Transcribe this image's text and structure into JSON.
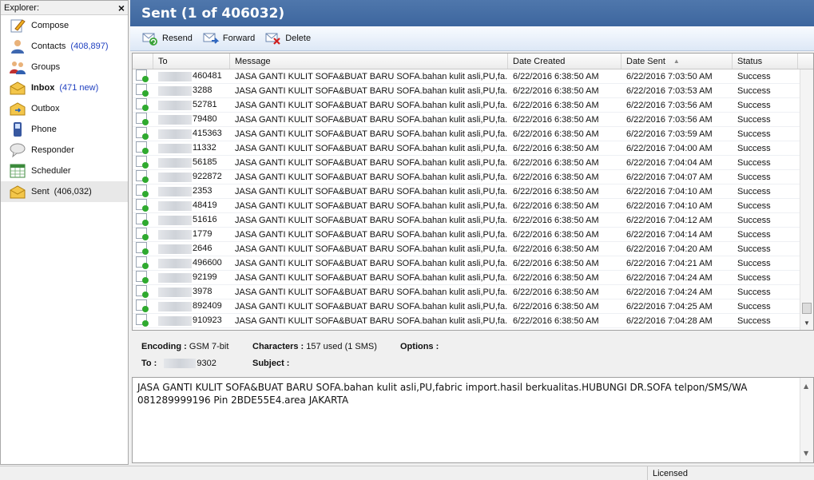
{
  "sidebar": {
    "title": "Explorer:",
    "items": [
      {
        "label": "Compose",
        "count": "",
        "icon": "compose-icon"
      },
      {
        "label": "Contacts",
        "count": "(408,897)",
        "icon": "contacts-icon"
      },
      {
        "label": "Groups",
        "count": "",
        "icon": "groups-icon"
      },
      {
        "label": "Inbox",
        "count": "(471 new)",
        "icon": "inbox-icon"
      },
      {
        "label": "Outbox",
        "count": "",
        "icon": "outbox-icon"
      },
      {
        "label": "Phone",
        "count": "",
        "icon": "phone-icon"
      },
      {
        "label": "Responder",
        "count": "",
        "icon": "responder-icon"
      },
      {
        "label": "Scheduler",
        "count": "",
        "icon": "scheduler-icon"
      },
      {
        "label": "Sent",
        "count": "(406,032)",
        "icon": "sent-icon"
      }
    ]
  },
  "header": {
    "title": "Sent (1 of 406032)"
  },
  "toolbar": {
    "resend": "Resend",
    "forward": "Forward",
    "delete": "Delete"
  },
  "grid": {
    "columns": [
      "To",
      "Message",
      "Date Created",
      "Date Sent",
      "Status"
    ],
    "rows": [
      {
        "to": "460481",
        "message": "JASA GANTI KULIT SOFA&BUAT BARU SOFA.bahan kulit asli,PU,fa...",
        "created": "6/22/2016 6:38:50 AM",
        "sent": "6/22/2016 7:03:50 AM",
        "status": "Success"
      },
      {
        "to": "3288",
        "message": "JASA GANTI KULIT SOFA&BUAT BARU SOFA.bahan kulit asli,PU,fa...",
        "created": "6/22/2016 6:38:50 AM",
        "sent": "6/22/2016 7:03:53 AM",
        "status": "Success"
      },
      {
        "to": "52781",
        "message": "JASA GANTI KULIT SOFA&BUAT BARU SOFA.bahan kulit asli,PU,fa...",
        "created": "6/22/2016 6:38:50 AM",
        "sent": "6/22/2016 7:03:56 AM",
        "status": "Success"
      },
      {
        "to": "79480",
        "message": "JASA GANTI KULIT SOFA&BUAT BARU SOFA.bahan kulit asli,PU,fa...",
        "created": "6/22/2016 6:38:50 AM",
        "sent": "6/22/2016 7:03:56 AM",
        "status": "Success"
      },
      {
        "to": "415363",
        "message": "JASA GANTI KULIT SOFA&BUAT BARU SOFA.bahan kulit asli,PU,fa...",
        "created": "6/22/2016 6:38:50 AM",
        "sent": "6/22/2016 7:03:59 AM",
        "status": "Success"
      },
      {
        "to": "11332",
        "message": "JASA GANTI KULIT SOFA&BUAT BARU SOFA.bahan kulit asli,PU,fa...",
        "created": "6/22/2016 6:38:50 AM",
        "sent": "6/22/2016 7:04:00 AM",
        "status": "Success"
      },
      {
        "to": "56185",
        "message": "JASA GANTI KULIT SOFA&BUAT BARU SOFA.bahan kulit asli,PU,fa...",
        "created": "6/22/2016 6:38:50 AM",
        "sent": "6/22/2016 7:04:04 AM",
        "status": "Success"
      },
      {
        "to": "922872",
        "message": "JASA GANTI KULIT SOFA&BUAT BARU SOFA.bahan kulit asli,PU,fa...",
        "created": "6/22/2016 6:38:50 AM",
        "sent": "6/22/2016 7:04:07 AM",
        "status": "Success"
      },
      {
        "to": "2353",
        "message": "JASA GANTI KULIT SOFA&BUAT BARU SOFA.bahan kulit asli,PU,fa...",
        "created": "6/22/2016 6:38:50 AM",
        "sent": "6/22/2016 7:04:10 AM",
        "status": "Success"
      },
      {
        "to": "48419",
        "message": "JASA GANTI KULIT SOFA&BUAT BARU SOFA.bahan kulit asli,PU,fa...",
        "created": "6/22/2016 6:38:50 AM",
        "sent": "6/22/2016 7:04:10 AM",
        "status": "Success"
      },
      {
        "to": "51616",
        "message": "JASA GANTI KULIT SOFA&BUAT BARU SOFA.bahan kulit asli,PU,fa...",
        "created": "6/22/2016 6:38:50 AM",
        "sent": "6/22/2016 7:04:12 AM",
        "status": "Success"
      },
      {
        "to": "1779",
        "message": "JASA GANTI KULIT SOFA&BUAT BARU SOFA.bahan kulit asli,PU,fa...",
        "created": "6/22/2016 6:38:50 AM",
        "sent": "6/22/2016 7:04:14 AM",
        "status": "Success"
      },
      {
        "to": "2646",
        "message": "JASA GANTI KULIT SOFA&BUAT BARU SOFA.bahan kulit asli,PU,fa...",
        "created": "6/22/2016 6:38:50 AM",
        "sent": "6/22/2016 7:04:20 AM",
        "status": "Success"
      },
      {
        "to": "496600",
        "message": "JASA GANTI KULIT SOFA&BUAT BARU SOFA.bahan kulit asli,PU,fa...",
        "created": "6/22/2016 6:38:50 AM",
        "sent": "6/22/2016 7:04:21 AM",
        "status": "Success"
      },
      {
        "to": "92199",
        "message": "JASA GANTI KULIT SOFA&BUAT BARU SOFA.bahan kulit asli,PU,fa...",
        "created": "6/22/2016 6:38:50 AM",
        "sent": "6/22/2016 7:04:24 AM",
        "status": "Success"
      },
      {
        "to": "3978",
        "message": "JASA GANTI KULIT SOFA&BUAT BARU SOFA.bahan kulit asli,PU,fa...",
        "created": "6/22/2016 6:38:50 AM",
        "sent": "6/22/2016 7:04:24 AM",
        "status": "Success"
      },
      {
        "to": "892409",
        "message": "JASA GANTI KULIT SOFA&BUAT BARU SOFA.bahan kulit asli,PU,fa...",
        "created": "6/22/2016 6:38:50 AM",
        "sent": "6/22/2016 7:04:25 AM",
        "status": "Success"
      },
      {
        "to": "910923",
        "message": "JASA GANTI KULIT SOFA&BUAT BARU SOFA.bahan kulit asli,PU,fa...",
        "created": "6/22/2016 6:38:50 AM",
        "sent": "6/22/2016 7:04:28 AM",
        "status": "Success"
      }
    ]
  },
  "details": {
    "encoding_label": "Encoding :",
    "encoding_value": "GSM 7-bit",
    "characters_label": "Characters :",
    "characters_value": "157 used (1 SMS)",
    "options_label": "Options :",
    "to_label": "To :",
    "to_value": "9302",
    "subject_label": "Subject :"
  },
  "message_body": "JASA GANTI KULIT SOFA&BUAT BARU SOFA.bahan kulit asli,PU,fabric import.hasil berkualitas.HUBUNGI DR.SOFA telpon/SMS/WA 081289999196 Pin 2BDE55E4.area JAKARTA",
  "statusbar": {
    "license": "Licensed"
  }
}
